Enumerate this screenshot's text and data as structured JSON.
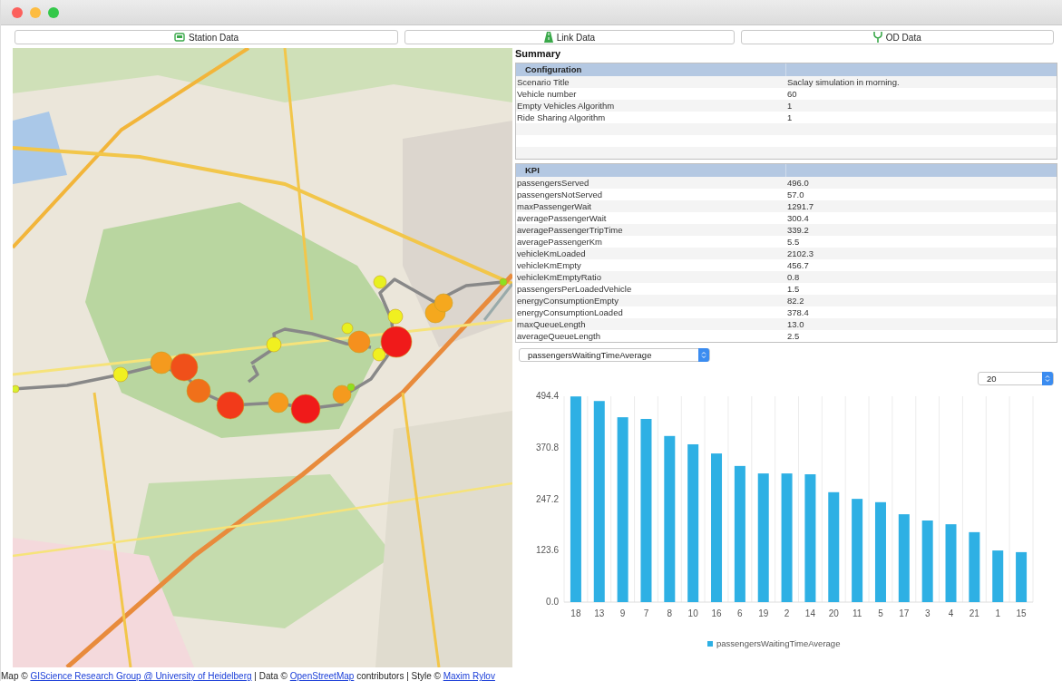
{
  "toolbar": [
    {
      "label": "Station Data",
      "kind": "station"
    },
    {
      "label": "Link Data",
      "kind": "link"
    },
    {
      "label": "OD Data",
      "kind": "od"
    }
  ],
  "attribution": [
    {
      "kind": "text",
      "text": "Map © "
    },
    {
      "kind": "link",
      "text": "GIScience Research Group @ University of Heidelberg"
    },
    {
      "kind": "text",
      "text": " | Data © "
    },
    {
      "kind": "link",
      "text": "OpenStreetMap"
    },
    {
      "kind": "text",
      "text": " contributors | Style © "
    },
    {
      "kind": "link",
      "text": "Maxim Rylov"
    }
  ],
  "summary": {
    "title": "Summary",
    "sections": [
      {
        "header": "Configuration",
        "rows": [
          {
            "name": "Scenario Title",
            "value": "Saclay simulation in morning."
          },
          {
            "name": "Vehicle number",
            "value": "60"
          },
          {
            "name": "Empty Vehicles Algorithm",
            "value": "1"
          },
          {
            "name": "Ride Sharing Algorithm",
            "value": "1"
          }
        ]
      },
      {
        "header": "KPI",
        "rows": [
          {
            "name": "passengersServed",
            "value": "496.0"
          },
          {
            "name": "passengersNotServed",
            "value": "57.0"
          },
          {
            "name": "maxPassengerWait",
            "value": "1291.7"
          },
          {
            "name": "averagePassengerWait",
            "value": "300.4"
          },
          {
            "name": "averagePassengerTripTime",
            "value": "339.2"
          },
          {
            "name": "averagePassengerKm",
            "value": "5.5"
          },
          {
            "name": "vehicleKmLoaded",
            "value": "2102.3"
          },
          {
            "name": "vehicleKmEmpty",
            "value": "456.7"
          },
          {
            "name": "vehicleKmEmptyRatio",
            "value": "0.8"
          },
          {
            "name": "passengersPerLoadedVehicle",
            "value": "1.5"
          },
          {
            "name": "energyConsumptionEmpty",
            "value": "82.2"
          },
          {
            "name": "energyConsumptionLoaded",
            "value": "378.4"
          },
          {
            "name": "maxQueueLength",
            "value": "13.0"
          },
          {
            "name": "averageQueueLength",
            "value": "2.5"
          }
        ]
      }
    ]
  },
  "metric_select": {
    "value": "passengersWaitingTimeAverage"
  },
  "count_select": {
    "value": "20"
  },
  "chart_data": {
    "type": "bar",
    "categories": [
      "18",
      "13",
      "9",
      "7",
      "8",
      "10",
      "16",
      "6",
      "19",
      "2",
      "14",
      "20",
      "11",
      "5",
      "17",
      "3",
      "4",
      "21",
      "1",
      "15"
    ],
    "series": [
      {
        "name": "passengersWaitingTimeAverage",
        "color": "#2eb0e4",
        "values": [
          494,
          483,
          444,
          440,
          399,
          379,
          357,
          327,
          309,
          309,
          307,
          264,
          248,
          240,
          211,
          196,
          187,
          168,
          124,
          120
        ]
      }
    ],
    "ylim": [
      0,
      494.4
    ],
    "yticks": [
      {
        "value": 0,
        "label": "0.0"
      },
      {
        "value": 123.6,
        "label": "123.6"
      },
      {
        "value": 247.2,
        "label": "247.2"
      },
      {
        "value": 370.8,
        "label": "370.8"
      },
      {
        "value": 494.4,
        "label": "494.4"
      }
    ]
  }
}
